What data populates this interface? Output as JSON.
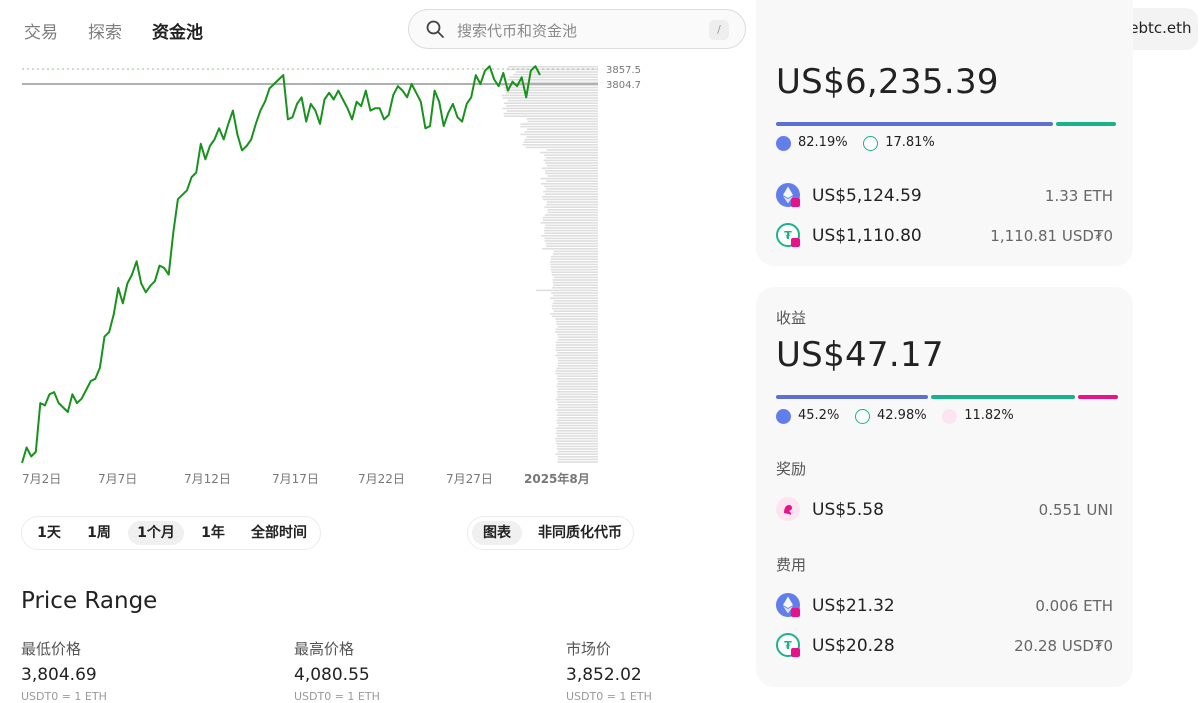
{
  "nav": {
    "items": [
      "交易",
      "探索",
      "资金池"
    ],
    "active_index": 2,
    "search_placeholder": "搜索代币和资金池",
    "search_shortcut": "/",
    "wallet_name": "webtc.eth"
  },
  "chart_data": {
    "type": "line",
    "x_tick_labels": [
      "7月2日",
      "7月7日",
      "7月12日",
      "7月17日",
      "7月22日",
      "7月27日",
      "2025年8月"
    ],
    "price_labels": [
      "3857.5",
      "3804.7"
    ],
    "line_color": "#17921c",
    "depth_color": "#dedede",
    "values": [
      2330,
      2400,
      2360,
      2380,
      2600,
      2590,
      2640,
      2650,
      2600,
      2580,
      2560,
      2640,
      2600,
      2620,
      2660,
      2700,
      2710,
      2760,
      2900,
      2920,
      3000,
      3120,
      3050,
      3140,
      3180,
      3240,
      3140,
      3100,
      3130,
      3150,
      3220,
      3210,
      3180,
      3370,
      3520,
      3540,
      3560,
      3620,
      3640,
      3770,
      3700,
      3760,
      3790,
      3840,
      3790,
      3860,
      3920,
      3810,
      3740,
      3760,
      3790,
      3860,
      3920,
      3960,
      4020,
      4040,
      4060,
      4080,
      3880,
      3890,
      3950,
      3980,
      3870,
      3950,
      3920,
      3860,
      3970,
      4000,
      3970,
      4010,
      3970,
      3930,
      3880,
      3960,
      3940,
      4010,
      3920,
      3930,
      3930,
      3880,
      3900,
      3990,
      4030,
      4010,
      3980,
      4040,
      4000,
      3960,
      3840,
      3850,
      4010,
      3960,
      3850,
      3910,
      3950,
      3890,
      3870,
      3950,
      3980,
      4080,
      4040,
      4100,
      4120,
      4060,
      4030,
      4090,
      4010,
      4050,
      4030,
      4070,
      3980,
      4100,
      4120,
      4080
    ]
  },
  "range_buttons": [
    "1天",
    "1周",
    "1个月",
    "1年",
    "全部时间"
  ],
  "range_selected": 2,
  "view_buttons": [
    "图表",
    "非同质化代币"
  ],
  "view_selected": 0,
  "price_range": {
    "title": "Price Range",
    "min": {
      "label": "最低价格",
      "value": "3,804.69",
      "sub": "USDT0 = 1 ETH"
    },
    "max": {
      "label": "最高价格",
      "value": "4,080.55",
      "sub": "USDT0 = 1 ETH"
    },
    "market": {
      "label": "市场价",
      "value": "3,852.02",
      "sub": "USDT0 = 1 ETH"
    }
  },
  "liquidity_card": {
    "total": "US$6,235.39",
    "shares": [
      {
        "icon": "eth-icon",
        "pct": "82.19%",
        "fraction": 0.8219,
        "color": "#5d6fd0"
      },
      {
        "icon": "usdt0-icon",
        "pct": "17.81%",
        "fraction": 0.1781,
        "color": "#19b38a"
      }
    ],
    "tokens": [
      {
        "icon": "eth-icon",
        "usd": "US$5,124.59",
        "amount": "1.33 ETH"
      },
      {
        "icon": "usdt0-icon",
        "usd": "US$1,110.80",
        "amount": "1,110.81 USD₮0"
      }
    ]
  },
  "earnings_card": {
    "label": "收益",
    "total": "US$47.17",
    "shares": [
      {
        "icon": "eth-icon",
        "pct": "45.2%",
        "fraction": 0.452,
        "color": "#5d6fd0"
      },
      {
        "icon": "usdt0-icon",
        "pct": "42.98%",
        "fraction": 0.4298,
        "color": "#19b38a"
      },
      {
        "icon": "uni-icon",
        "pct": "11.82%",
        "fraction": 0.1182,
        "color": "#e8138b"
      }
    ],
    "rewards_label": "奖励",
    "reward": {
      "icon": "uni-icon",
      "usd": "US$5.58",
      "amount": "0.551 UNI"
    },
    "fees_label": "费用",
    "fees": [
      {
        "icon": "eth-icon",
        "usd": "US$21.32",
        "amount": "0.006 ETH"
      },
      {
        "icon": "usdt0-icon",
        "usd": "US$20.28",
        "amount": "20.28 USD₮0"
      }
    ]
  }
}
